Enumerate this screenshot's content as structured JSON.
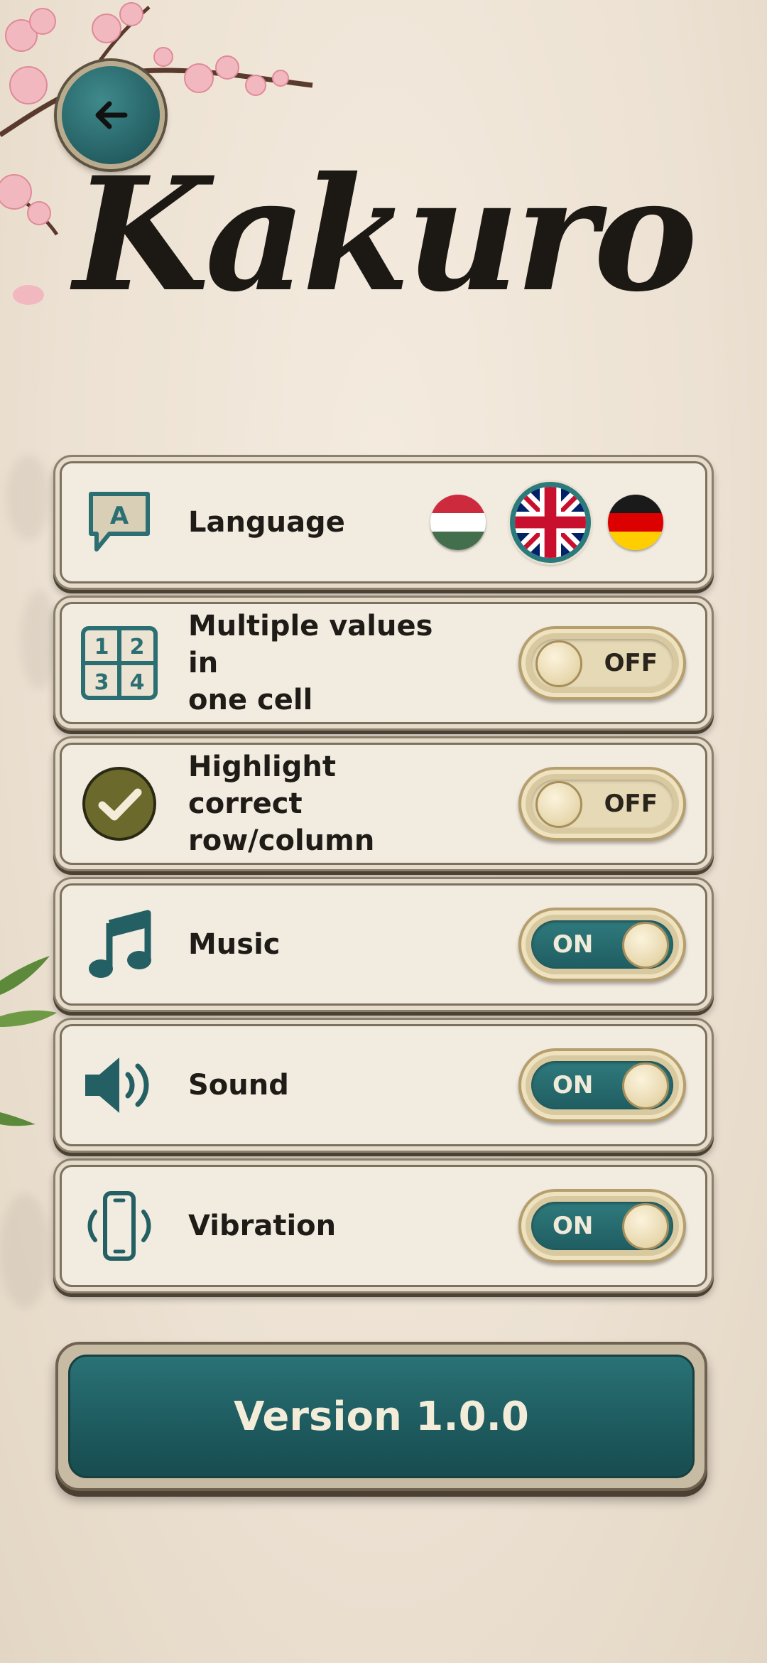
{
  "header": {
    "title": "Kakuro",
    "back_icon": "arrow-left-icon"
  },
  "settings": {
    "language": {
      "label": "Language",
      "icon": "speech-bubble-a-icon",
      "icon_letter": "A",
      "options": [
        "hungarian-flag",
        "uk-flag",
        "german-flag"
      ],
      "selected": "uk-flag"
    },
    "multiple_values": {
      "label_line1": "Multiple values in",
      "label_line2": "one cell",
      "icon": "number-grid-icon",
      "grid_digits": [
        "1",
        "2",
        "3",
        "4"
      ],
      "toggle": "OFF"
    },
    "highlight": {
      "label_line1": "Highlight correct",
      "label_line2": "row/column",
      "icon": "checkmark-circle-icon",
      "toggle": "OFF"
    },
    "music": {
      "label": "Music",
      "icon": "music-note-icon",
      "toggle": "ON"
    },
    "sound": {
      "label": "Sound",
      "icon": "speaker-icon",
      "toggle": "ON"
    },
    "vibration": {
      "label": "Vibration",
      "icon": "phone-vibrate-icon",
      "toggle": "ON"
    }
  },
  "footer": {
    "version": "Version 1.0.0"
  },
  "colors": {
    "accent": "#2b7a7c",
    "background": "#ede3d5",
    "text": "#1f1b16",
    "check": "#6b6a2c"
  }
}
